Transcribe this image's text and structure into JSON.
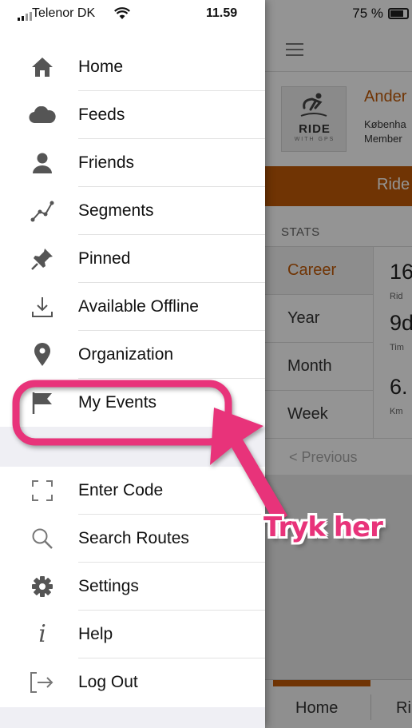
{
  "status": {
    "carrier": "Telenor DK",
    "time": "11.59",
    "battery": "75 %"
  },
  "drawer": {
    "items": [
      {
        "label": "Home",
        "icon": "home-icon"
      },
      {
        "label": "Feeds",
        "icon": "cloud-icon"
      },
      {
        "label": "Friends",
        "icon": "person-icon"
      },
      {
        "label": "Segments",
        "icon": "segments-icon"
      },
      {
        "label": "Pinned",
        "icon": "pin-icon"
      },
      {
        "label": "Available Offline",
        "icon": "download-icon"
      },
      {
        "label": "Organization",
        "icon": "location-pin-icon"
      },
      {
        "label": "My Events",
        "icon": "flag-icon"
      }
    ],
    "secondary_items": [
      {
        "label": "Enter Code",
        "icon": "scan-frame-icon"
      },
      {
        "label": "Search Routes",
        "icon": "search-icon"
      },
      {
        "label": "Settings",
        "icon": "gear-icon"
      },
      {
        "label": "Help",
        "icon": "info-icon"
      },
      {
        "label": "Log Out",
        "icon": "logout-icon"
      }
    ]
  },
  "background": {
    "logo_text": "RIDE",
    "logo_subtext": "WITH GPS",
    "profile": {
      "name": "Ander",
      "location": "Københa",
      "member": "Member"
    },
    "ride_button": "Ride",
    "stats_title": "STATS",
    "stats_tabs": [
      "Career",
      "Year",
      "Month",
      "Week"
    ],
    "stat_values": [
      {
        "value": "16",
        "label": "Rid"
      },
      {
        "value": "9d",
        "label": "Tim"
      },
      {
        "value": "6.",
        "label": "Km"
      }
    ],
    "previous_label": "< Previous",
    "bottom_tabs": [
      "Home",
      "Ri"
    ]
  },
  "annotation": {
    "text": "Tryk her",
    "color": "#e8337a"
  },
  "colors": {
    "accent": "#c25b07",
    "annotation": "#e8337a"
  }
}
